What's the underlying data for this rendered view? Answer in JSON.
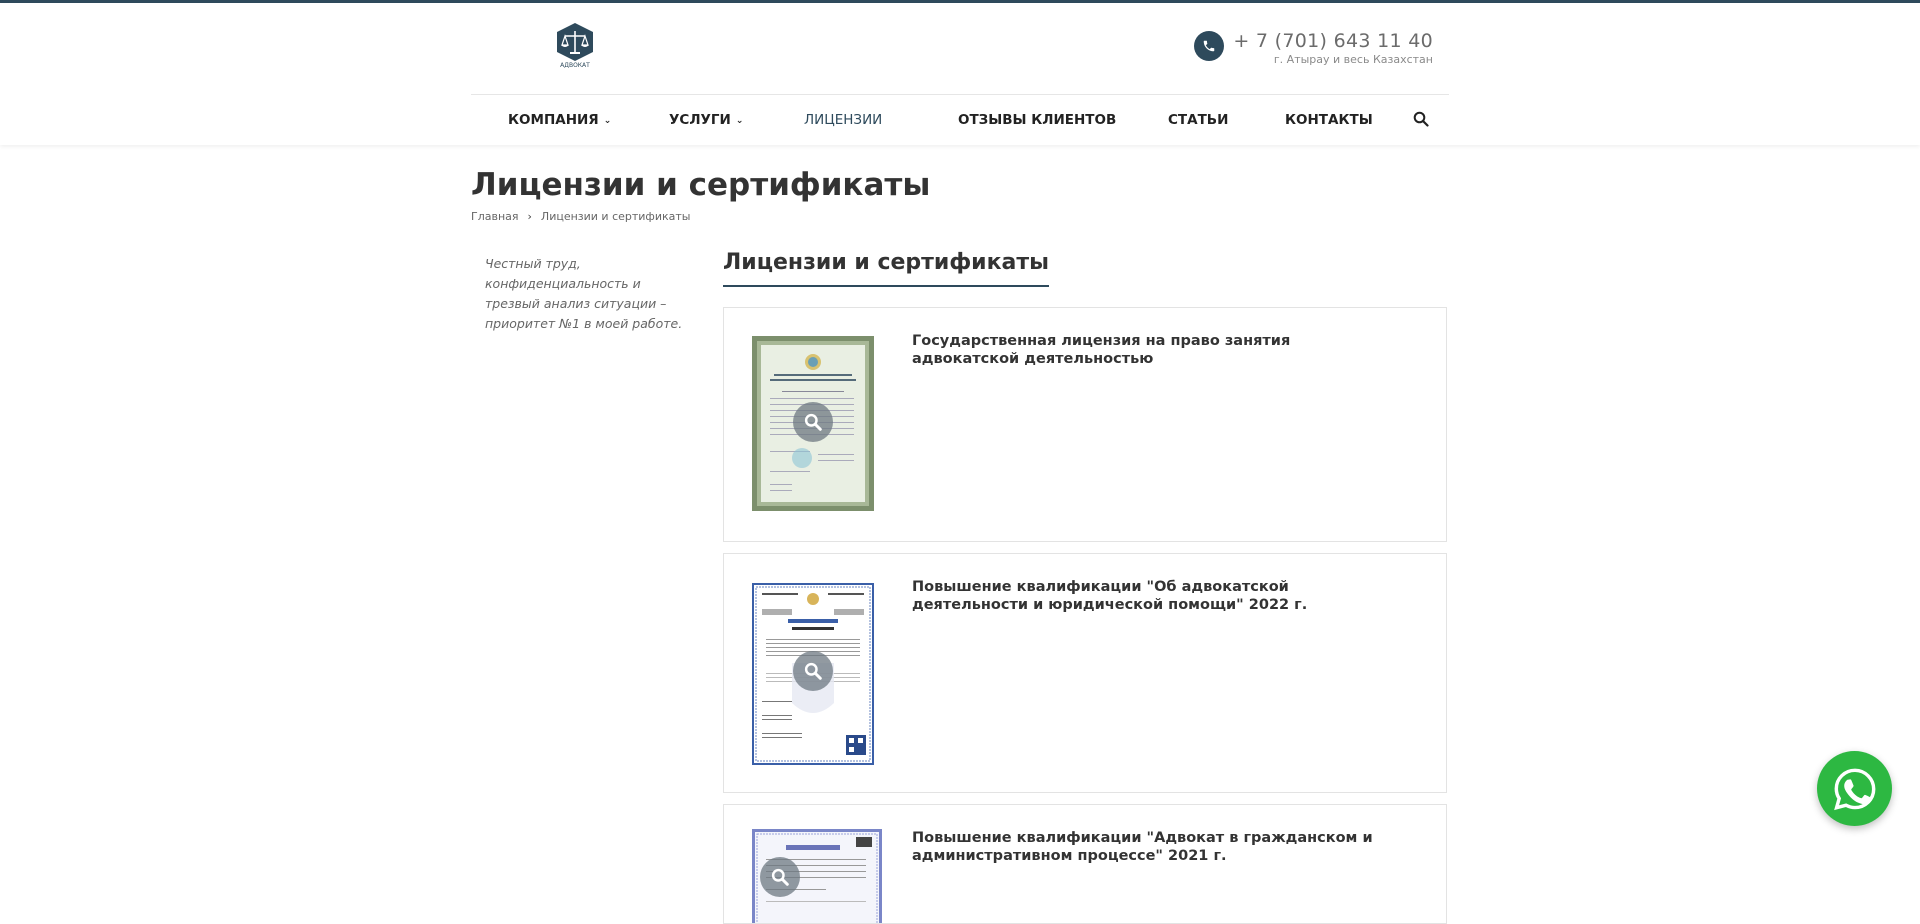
{
  "colors": {
    "brand": "#2e4a5c",
    "whatsapp": "#2db842",
    "text": "#333333",
    "muted": "#666666"
  },
  "header": {
    "logo_text": "АДВОКАТ",
    "phone": "+ 7 (701) 643 11 40",
    "city": "г. Атырау и весь Казахстан"
  },
  "nav": {
    "items": [
      {
        "label": "КОМПАНИЯ",
        "has_dropdown": true
      },
      {
        "label": "УСЛУГИ",
        "has_dropdown": true
      },
      {
        "label": "ЛИЦЕНЗИИ",
        "active": true
      },
      {
        "label": "ОТЗЫВЫ КЛИЕНТОВ"
      },
      {
        "label": "СТАТЬИ"
      },
      {
        "label": "КОНТАКТЫ"
      }
    ],
    "search_icon": "search-icon"
  },
  "page": {
    "title": "Лицензии и сертификаты",
    "breadcrumb": [
      "Главная",
      "Лицензии и сертификаты"
    ]
  },
  "sidebar": {
    "motto": "Честный труд, конфиденциальность и трезвый анализ ситуации – приоритет №1 в моей работе."
  },
  "content": {
    "section_title": "Лицензии и сертификаты",
    "items": [
      {
        "title": "Государственная лицензия на право занятия адвокатской деятельностью"
      },
      {
        "title": "Повышение квалификации \"Об адвокатской деятельности и юридической помощи\" 2022 г."
      },
      {
        "title": "Повышение квалификации \"Адвокат в гражданском и административном процессе\" 2021 г."
      }
    ]
  },
  "icons": {
    "phone": "phone-icon",
    "zoom": "zoom-icon",
    "whatsapp": "whatsapp-icon"
  }
}
